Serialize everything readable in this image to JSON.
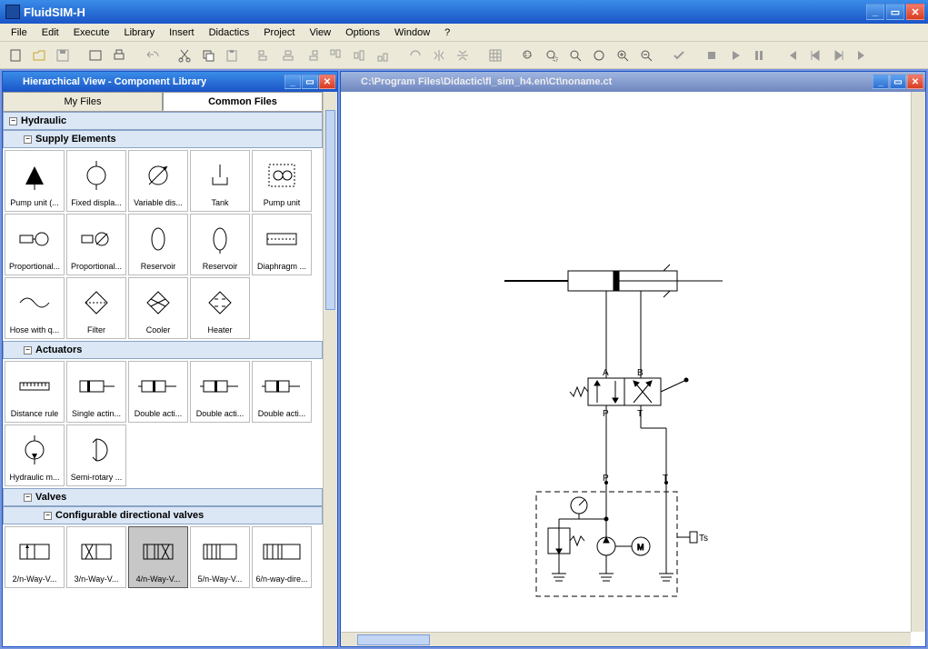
{
  "app": {
    "title": "FluidSIM-H"
  },
  "menu": [
    "File",
    "Edit",
    "Execute",
    "Library",
    "Insert",
    "Didactics",
    "Project",
    "View",
    "Options",
    "Window",
    "?"
  ],
  "left_window": {
    "title": "Hierarchical View - Component Library",
    "tabs": {
      "my_files": "My Files",
      "common_files": "Common Files"
    },
    "tree": {
      "hydraulic": "Hydraulic",
      "supply": "Supply Elements",
      "supply_items": [
        "Pump unit (...",
        "Fixed displa...",
        "Variable dis...",
        "Tank",
        "Pump unit",
        "Proportional...",
        "Proportional...",
        "Reservoir",
        "Reservoir",
        "Diaphragm ...",
        "Hose with q...",
        "Filter",
        "Cooler",
        "Heater"
      ],
      "actuators": "Actuators",
      "actuator_items": [
        "Distance rule",
        "Single actin...",
        "Double acti...",
        "Double acti...",
        "Double acti...",
        "Hydraulic m...",
        "Semi-rotary ..."
      ],
      "valves": "Valves",
      "config_dir": "Configurable directional valves",
      "valve_items": [
        "2/n-Way-V...",
        "3/n-Way-V...",
        "4/n-Way-V...",
        "5/n-Way-V...",
        "6/n-way-dire..."
      ]
    }
  },
  "right_window": {
    "title": "C:\\Program Files\\Didactic\\fl_sim_h4.en\\Ct\\noname.ct",
    "ports": {
      "a": "A",
      "b": "B",
      "p": "P",
      "t": "T",
      "p2": "P",
      "t2": "T",
      "ts": "Ts",
      "m": "M"
    }
  }
}
